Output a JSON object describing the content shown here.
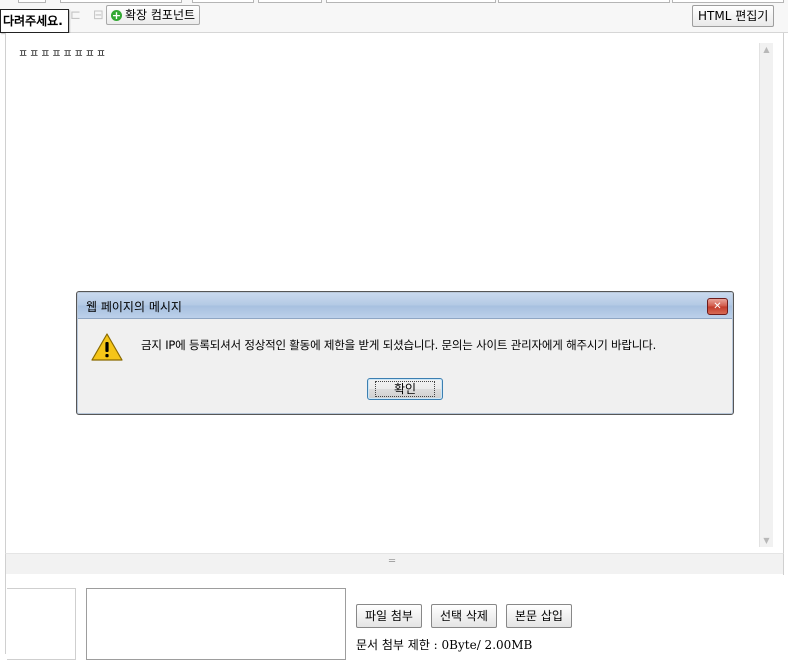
{
  "toolbar": {
    "tooltip_text": "다려주세요.",
    "ext_component_label": "확장 컴포넌트",
    "html_editor_label": "HTML 편집기"
  },
  "editor": {
    "content_text": "ㅍㅍㅍㅍㅍㅍㅍㅍ"
  },
  "attachments": {
    "attach_file_label": "파일 첨부",
    "delete_selected_label": "선택 삭제",
    "insert_body_label": "본문 삽입",
    "limit_text": "문서 첨부 제한 : 0Byte/ 2.00MB"
  },
  "dialog": {
    "title": "웹 페이지의 메시지",
    "close_glyph": "✕",
    "message": "금지 IP에 등록되셔서 정상적인 활동에 제한을 받게 되셨습니다. 문의는 사이트 관리자에게 해주시기 바랍니다.",
    "ok_label": "확인",
    "icon": "warning-icon"
  },
  "colors": {
    "dialog_title_gradient_top": "#c9d9ee",
    "dialog_title_gradient_bottom": "#a7c0df",
    "close_button_red": "#c23a2a",
    "warning_yellow": "#f5c518",
    "add_icon_green": "#33a833"
  }
}
